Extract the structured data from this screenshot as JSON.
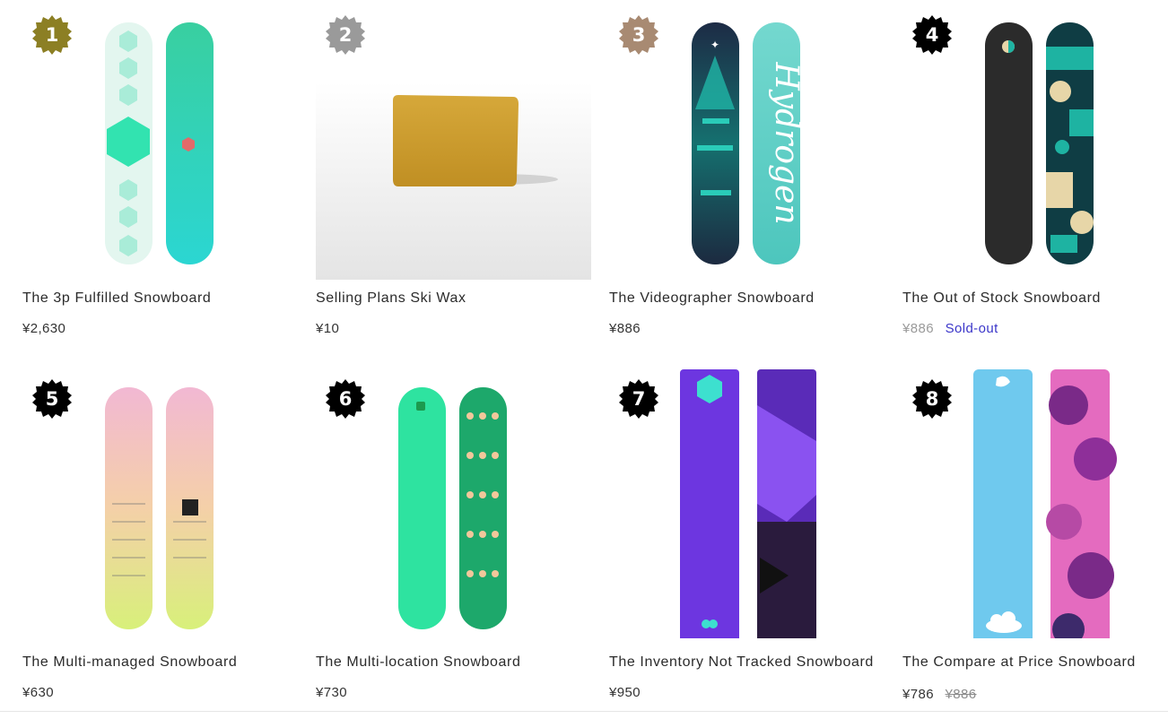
{
  "products": [
    {
      "rank": "1",
      "title": "The 3p Fulfilled Snowboard",
      "price": "¥2,630",
      "badge_color": "#8c7f24"
    },
    {
      "rank": "2",
      "title": "Selling Plans Ski Wax",
      "price": "¥10",
      "badge_color": "#9a9a9a"
    },
    {
      "rank": "3",
      "title": "The Videographer Snowboard",
      "price": "¥886",
      "badge_color": "#a88a72"
    },
    {
      "rank": "4",
      "title": "The Out of Stock Snowboard",
      "price": "¥886",
      "status": "Sold-out",
      "badge_color": "#000000"
    },
    {
      "rank": "5",
      "title": "The Multi-managed Snowboard",
      "price": "¥630",
      "badge_color": "#000000"
    },
    {
      "rank": "6",
      "title": "The Multi-location Snowboard",
      "price": "¥730",
      "badge_color": "#000000"
    },
    {
      "rank": "7",
      "title": "The Inventory Not Tracked Snowboard",
      "price": "¥950",
      "badge_color": "#000000"
    },
    {
      "rank": "8",
      "title": "The Compare at Price Snowboard",
      "price": "¥786",
      "compare_price": "¥886",
      "badge_color": "#000000"
    }
  ],
  "icons": {
    "rank_badge": "starburst-badge-icon"
  }
}
